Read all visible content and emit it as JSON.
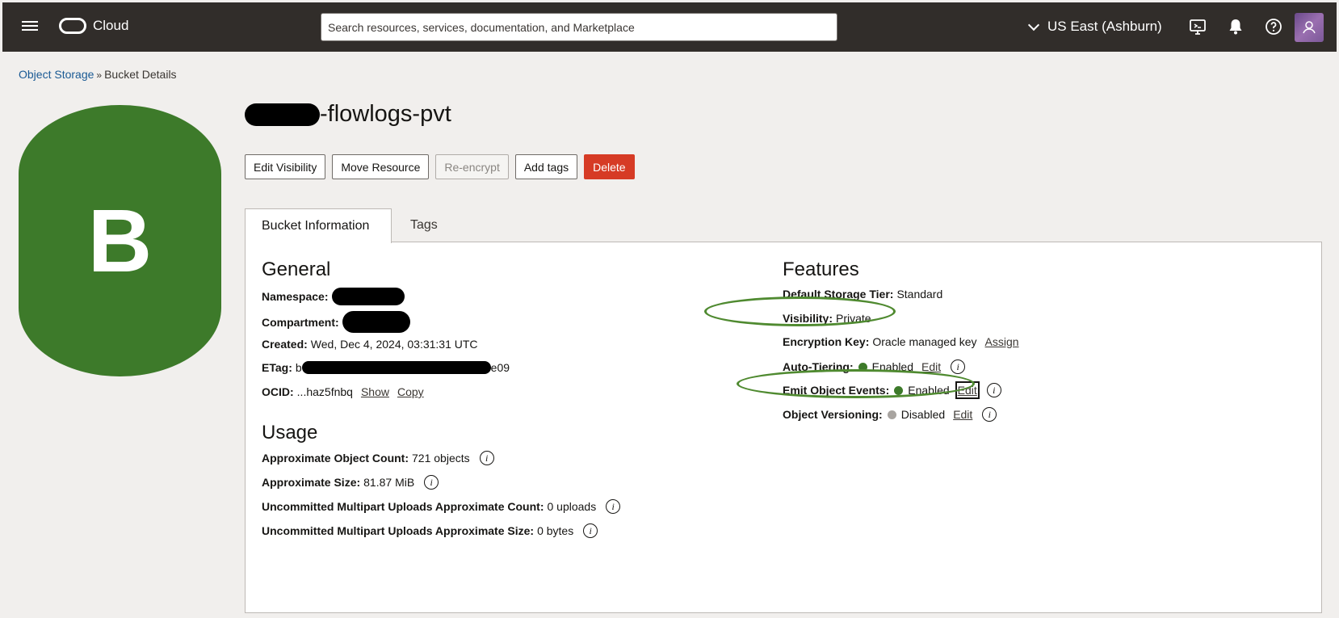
{
  "header": {
    "brand": "Cloud",
    "search_placeholder": "Search resources, services, documentation, and Marketplace",
    "region": "US East (Ashburn)"
  },
  "breadcrumb": {
    "parent": "Object Storage",
    "separator": "»",
    "current": "Bucket Details"
  },
  "bucket": {
    "icon_letter": "B",
    "name_suffix": "-flowlogs-pvt"
  },
  "actions": {
    "edit_visibility": "Edit Visibility",
    "move_resource": "Move Resource",
    "reencrypt": "Re-encrypt",
    "add_tags": "Add tags",
    "delete": "Delete"
  },
  "tabs": {
    "bucket_information": "Bucket Information",
    "tags": "Tags"
  },
  "general": {
    "title": "General",
    "namespace_label": "Namespace:",
    "compartment_label": "Compartment:",
    "created_label": "Created:",
    "created_value": "Wed, Dec 4, 2024, 03:31:31 UTC",
    "etag_label": "ETag:",
    "etag_prefix": "b",
    "etag_suffix": "e09",
    "ocid_label": "OCID:",
    "ocid_value": "...haz5fnbq",
    "show": "Show",
    "copy": "Copy"
  },
  "usage": {
    "title": "Usage",
    "object_count_label": "Approximate Object Count:",
    "object_count_value": "721 objects",
    "size_label": "Approximate Size:",
    "size_value": "81.87 MiB",
    "multipart_count_label": "Uncommitted Multipart Uploads Approximate Count:",
    "multipart_count_value": "0 uploads",
    "multipart_size_label": "Uncommitted Multipart Uploads Approximate Size:",
    "multipart_size_value": "0 bytes"
  },
  "features": {
    "title": "Features",
    "storage_tier_label": "Default Storage Tier:",
    "storage_tier_value": "Standard",
    "visibility_label": "Visibility:",
    "visibility_value": "Private",
    "encryption_label": "Encryption Key:",
    "encryption_value": "Oracle managed key",
    "assign": "Assign",
    "auto_tiering_label": "Auto-Tiering:",
    "auto_tiering_value": "Enabled",
    "emit_events_label": "Emit Object Events:",
    "emit_events_value": "Enabled",
    "versioning_label": "Object Versioning:",
    "versioning_value": "Disabled",
    "edit": "Edit"
  },
  "colors": {
    "enabled": "#3d7a2a",
    "disabled": "#a8a4a0",
    "delete": "#d63b25",
    "highlight": "#4f8a30"
  }
}
